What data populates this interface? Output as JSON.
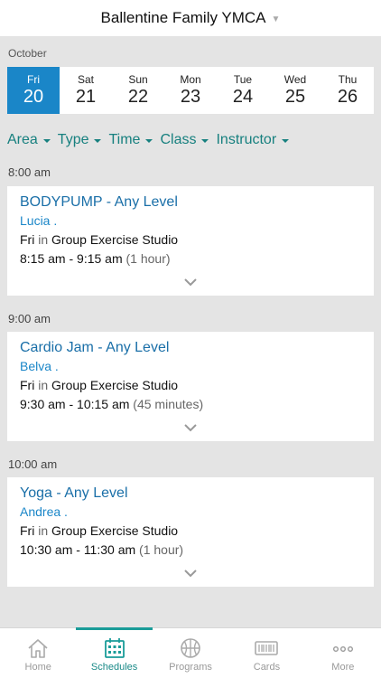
{
  "header": {
    "title": "Ballentine Family YMCA"
  },
  "calendar": {
    "month": "October",
    "days": [
      {
        "dow": "Fri",
        "num": "20"
      },
      {
        "dow": "Sat",
        "num": "21"
      },
      {
        "dow": "Sun",
        "num": "22"
      },
      {
        "dow": "Mon",
        "num": "23"
      },
      {
        "dow": "Tue",
        "num": "24"
      },
      {
        "dow": "Wed",
        "num": "25"
      },
      {
        "dow": "Thu",
        "num": "26"
      }
    ]
  },
  "filters": [
    "Area",
    "Type",
    "Time",
    "Class",
    "Instructor"
  ],
  "sections": [
    {
      "time": "8:00 am",
      "class": {
        "name": "BODYPUMP - Any Level",
        "instructor": "Lucia .",
        "day": "Fri",
        "in": "in",
        "location": "Group Exercise Studio",
        "time_range": "8:15 am - 9:15 am",
        "duration": "(1 hour)"
      }
    },
    {
      "time": "9:00 am",
      "class": {
        "name": "Cardio Jam - Any Level",
        "instructor": "Belva .",
        "day": "Fri",
        "in": "in",
        "location": "Group Exercise Studio",
        "time_range": "9:30 am - 10:15 am",
        "duration": "(45 minutes)"
      }
    },
    {
      "time": "10:00 am",
      "class": {
        "name": "Yoga - Any Level",
        "instructor": "Andrea .",
        "day": "Fri",
        "in": "in",
        "location": "Group Exercise Studio",
        "time_range": "10:30 am - 11:30 am",
        "duration": "(1 hour)"
      }
    }
  ],
  "tabs": [
    {
      "label": "Home",
      "icon": "home-icon"
    },
    {
      "label": "Schedules",
      "icon": "calendar-icon"
    },
    {
      "label": "Programs",
      "icon": "basketball-icon"
    },
    {
      "label": "Cards",
      "icon": "barcode-card-icon"
    },
    {
      "label": "More",
      "icon": "more-dots-icon"
    }
  ],
  "colors": {
    "accent": "#1a86c8",
    "teal": "#17807f",
    "background": "#e4e4e4"
  }
}
